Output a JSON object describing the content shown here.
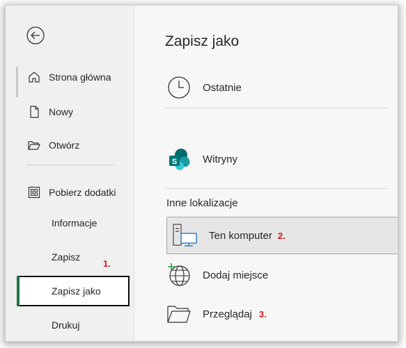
{
  "sidebar": {
    "back_label": "",
    "items": [
      {
        "label": "Strona główna"
      },
      {
        "label": "Nowy"
      },
      {
        "label": "Otwórz"
      },
      {
        "label": "Pobierz dodatki"
      },
      {
        "label": "Informacje"
      },
      {
        "label": "Zapisz",
        "step": "1."
      },
      {
        "label": "Zapisz jako",
        "selected": true
      },
      {
        "label": "Drukuj"
      }
    ]
  },
  "main": {
    "title": "Zapisz jako",
    "recent": {
      "label": "Ostatnie"
    },
    "sites": {
      "label": "Witryny"
    },
    "other_header": "Inne lokalizacje",
    "this_pc": {
      "label": "Ten komputer",
      "step": "2."
    },
    "add_place": {
      "label": "Dodaj miejsce"
    },
    "browse": {
      "label": "Przeglądaj",
      "step": "3."
    }
  },
  "colors": {
    "accent_green": "#217346",
    "step_red": "#d61818",
    "sharepoint_teal": "#038387"
  },
  "icons": {
    "back": "back-arrow-icon",
    "home": "home-icon",
    "new": "new-document-icon",
    "open": "open-folder-icon",
    "addins": "add-ins-icon",
    "recent": "clock-icon",
    "sites": "sharepoint-icon",
    "this_pc": "computer-icon",
    "add_place": "globe-add-icon",
    "browse": "folder-icon"
  }
}
